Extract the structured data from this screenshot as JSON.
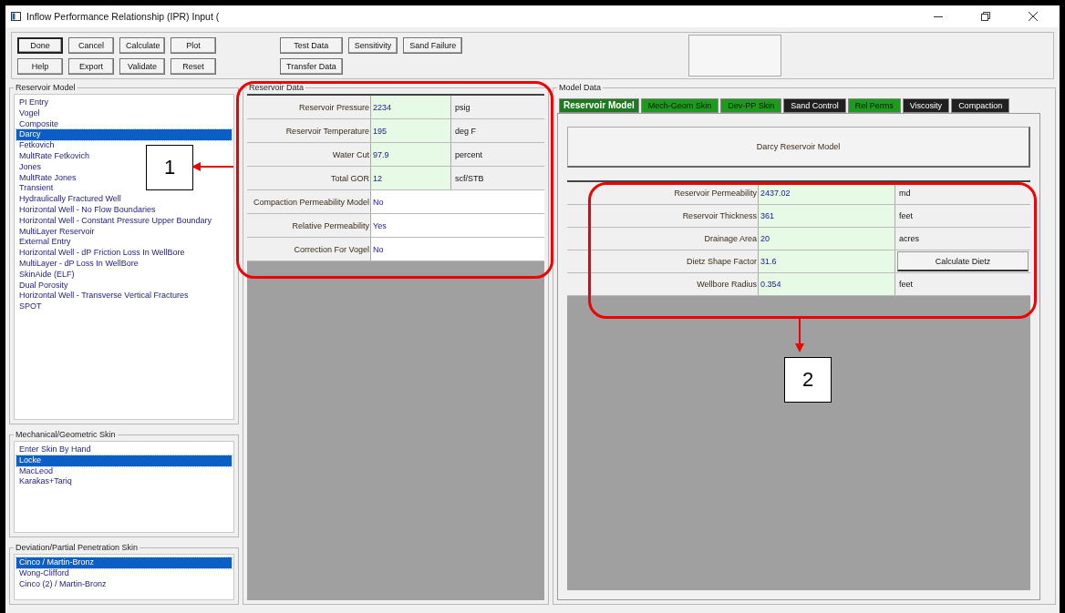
{
  "window": {
    "title": "Inflow Performance Relationship (IPR) Input ("
  },
  "toolbar": {
    "left_buttons": [
      {
        "label": "Done",
        "default": true
      },
      {
        "label": "Cancel",
        "default": false
      },
      {
        "label": "Calculate",
        "default": false
      },
      {
        "label": "Plot",
        "default": false
      },
      {
        "label": "Help",
        "default": false
      },
      {
        "label": "Export",
        "default": false
      },
      {
        "label": "Validate",
        "default": false
      },
      {
        "label": "Reset",
        "default": false
      }
    ],
    "right_buttons": [
      {
        "label": "Test Data",
        "default": false
      },
      {
        "label": "Sensitivity",
        "default": false
      },
      {
        "label": "Sand Failure",
        "default": false
      },
      {
        "label": "Transfer Data",
        "default": false
      }
    ]
  },
  "reservoir_model": {
    "title": "Reservoir Model",
    "items": [
      {
        "label": "PI Entry",
        "selected": false
      },
      {
        "label": "Vogel",
        "selected": false
      },
      {
        "label": "Composite",
        "selected": false
      },
      {
        "label": "Darcy",
        "selected": true
      },
      {
        "label": "Fetkovich",
        "selected": false
      },
      {
        "label": "MultRate Fetkovich",
        "selected": false
      },
      {
        "label": "Jones",
        "selected": false
      },
      {
        "label": "MultRate Jones",
        "selected": false
      },
      {
        "label": "Transient",
        "selected": false
      },
      {
        "label": "Hydraulically Fractured Well",
        "selected": false
      },
      {
        "label": "Horizontal Well - No Flow Boundaries",
        "selected": false
      },
      {
        "label": "Horizontal Well - Constant Pressure Upper Boundary",
        "selected": false
      },
      {
        "label": "MultiLayer Reservoir",
        "selected": false
      },
      {
        "label": "External Entry",
        "selected": false
      },
      {
        "label": "Horizontal Well - dP Friction Loss In WellBore",
        "selected": false
      },
      {
        "label": "MultiLayer - dP Loss In WellBore",
        "selected": false
      },
      {
        "label": "SkinAide (ELF)",
        "selected": false
      },
      {
        "label": "Dual Porosity",
        "selected": false
      },
      {
        "label": "Horizontal Well - Transverse Vertical Fractures",
        "selected": false
      },
      {
        "label": "SPOT",
        "selected": false
      }
    ]
  },
  "mechanical_skin": {
    "title": "Mechanical/Geometric Skin",
    "items": [
      {
        "label": "Enter Skin By Hand",
        "selected": false
      },
      {
        "label": "Locke",
        "selected": true
      },
      {
        "label": "MacLeod",
        "selected": false
      },
      {
        "label": "Karakas+Tariq",
        "selected": false
      }
    ]
  },
  "deviation_skin": {
    "title": "Deviation/Partial Penetration Skin",
    "items": [
      {
        "label": "Cinco / Martin-Bronz",
        "selected": true
      },
      {
        "label": "Wong-Clifford",
        "selected": false
      },
      {
        "label": "Cinco (2) / Martin-Bronz",
        "selected": false
      }
    ]
  },
  "reservoir_data": {
    "title": "Reservoir Data",
    "rows": [
      {
        "kind": "unit",
        "label": "Reservoir Pressure",
        "value": "2234",
        "unit": "psig"
      },
      {
        "kind": "unit",
        "label": "Reservoir Temperature",
        "value": "195",
        "unit": "deg F"
      },
      {
        "kind": "unit",
        "label": "Water Cut",
        "value": "97.9",
        "unit": "percent"
      },
      {
        "kind": "unit",
        "label": "Total GOR",
        "value": "12",
        "unit": "scf/STB"
      },
      {
        "kind": "choice",
        "label": "Compaction Permeability Model",
        "value": "No"
      },
      {
        "kind": "choice",
        "label": "Relative Permeability",
        "value": "Yes"
      },
      {
        "kind": "choice",
        "label": "Correction For Vogel",
        "value": "No"
      }
    ]
  },
  "model_data": {
    "title": "Model Data",
    "tabs": [
      {
        "label": "Reservoir Model",
        "selected": true,
        "color": "#1e7a1e"
      },
      {
        "label": "Mech-Geom Skin",
        "selected": false,
        "color": "#1e9a1e"
      },
      {
        "label": "Dev-PP Skin",
        "selected": false,
        "color": "#1e9a1e"
      },
      {
        "label": "Sand Control",
        "selected": false,
        "color": "#202020"
      },
      {
        "label": "Rel Perms",
        "selected": false,
        "color": "#1e9a1e"
      },
      {
        "label": "Viscosity",
        "selected": false,
        "color": "#202020"
      },
      {
        "label": "Compaction",
        "selected": false,
        "color": "#202020"
      }
    ],
    "model_button": "Darcy Reservoir Model",
    "rows": [
      {
        "kind": "unit",
        "label": "Reservoir Permeability",
        "value": "2437.02",
        "unit": "md"
      },
      {
        "kind": "unit",
        "label": "Reservoir Thickness",
        "value": "361",
        "unit": "feet"
      },
      {
        "kind": "unit",
        "label": "Drainage Area",
        "value": "20",
        "unit": "acres"
      },
      {
        "kind": "button",
        "label": "Dietz Shape Factor",
        "value": "31.6",
        "button": "Calculate Dietz"
      },
      {
        "kind": "unit",
        "label": "Wellbore Radius",
        "value": "0.354",
        "unit": "feet"
      }
    ]
  },
  "callouts": [
    {
      "label": "1"
    },
    {
      "label": "2"
    }
  ]
}
